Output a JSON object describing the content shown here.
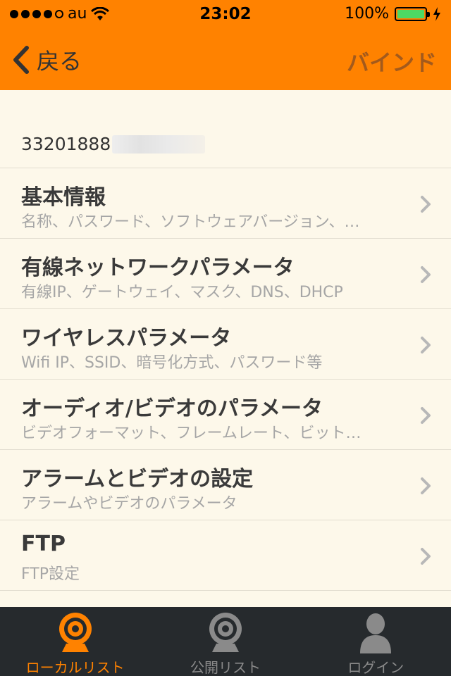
{
  "status_bar": {
    "carrier": "au",
    "time": "23:02",
    "battery": "100%"
  },
  "nav": {
    "back_label": "戻る",
    "action_label": "バインド"
  },
  "device": {
    "id_prefix": "33201888"
  },
  "menu": [
    {
      "title": "基本情報",
      "subtitle": "名称、パスワード、ソフトウェアバージョン、…"
    },
    {
      "title": "有線ネットワークパラメータ",
      "subtitle": "有線IP、ゲートウェイ、マスク、DNS、DHCP"
    },
    {
      "title": "ワイヤレスパラメータ",
      "subtitle": "Wifi IP、SSID、暗号化方式、パスワード等"
    },
    {
      "title": "オーディオ/ビデオのパラメータ",
      "subtitle": "ビデオフォーマット、フレームレート、ビット…"
    },
    {
      "title": "アラームとビデオの設定",
      "subtitle": "アラームやビデオのパラメータ"
    },
    {
      "title": "FTP",
      "subtitle": "FTP設定"
    }
  ],
  "tabs": [
    {
      "label": "ローカルリスト",
      "icon": "webcam-icon",
      "active": true
    },
    {
      "label": "公開リスト",
      "icon": "webcam-icon",
      "active": false
    },
    {
      "label": "ログイン",
      "icon": "person-icon",
      "active": false
    }
  ],
  "colors": {
    "accent": "#ff8200",
    "background": "#fdf8ea",
    "tabbar": "#262a2d",
    "bind_text": "#a35a1c"
  }
}
